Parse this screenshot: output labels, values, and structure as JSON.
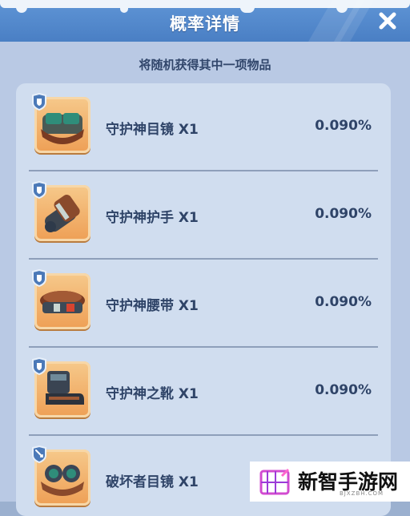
{
  "dialog": {
    "title": "概率详情",
    "subtitle": "将随机获得其中一项物品"
  },
  "items": [
    {
      "name": "守护神目镜 X1",
      "probability": "0.090%",
      "badge_icon": "shield-badge-icon",
      "item_icon": "goggles-icon"
    },
    {
      "name": "守护神护手 X1",
      "probability": "0.090%",
      "badge_icon": "shield-badge-icon",
      "item_icon": "gauntlet-icon"
    },
    {
      "name": "守护神腰带 X1",
      "probability": "0.090%",
      "badge_icon": "shield-badge-icon",
      "item_icon": "belt-icon"
    },
    {
      "name": "守护神之靴 X1",
      "probability": "0.090%",
      "badge_icon": "shield-badge-icon",
      "item_icon": "boots-icon"
    },
    {
      "name": "破坏者目镜 X1",
      "probability": "",
      "badge_icon": "sword-badge-icon",
      "item_icon": "goggles-icon"
    }
  ],
  "watermark": {
    "text": "新智手游网",
    "sub": "BJXZBH.COM"
  },
  "colors": {
    "header": "#4a7fc4",
    "panel": "#b9c9e4",
    "list_bg": "#d0ddef",
    "text": "#2f4468",
    "icon_bg": "#ee9f55"
  }
}
